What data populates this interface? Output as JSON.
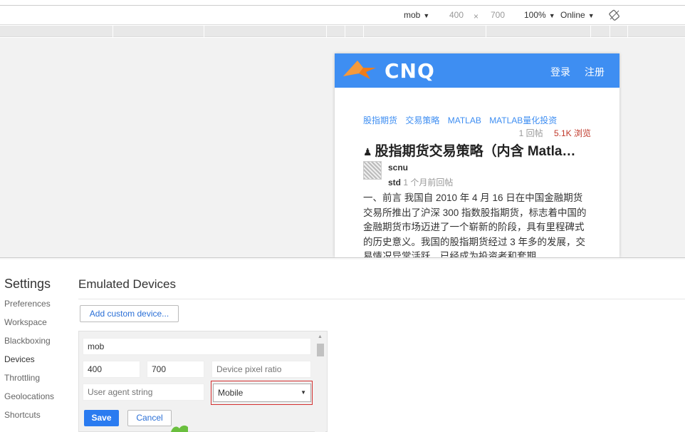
{
  "toolbar": {
    "device": "mob",
    "width": "400",
    "times": "×",
    "height": "700",
    "zoom": "100%",
    "network": "Online",
    "arrow": "▼"
  },
  "site": {
    "logo_text": "CNQ",
    "login": "登录",
    "register": "注册",
    "brand_color": "#3e8ef2"
  },
  "post": {
    "tags": [
      "股指期货",
      "交易策略",
      "MATLAB",
      "MATLAB量化投资"
    ],
    "replies": "1 回帖",
    "views": "5.1K 浏览",
    "pin_icon": "♟",
    "title": "股指期货交易策略（内含 Matla…",
    "author": "scnu",
    "sub_user": "std",
    "sub_time": "1 个月前回帖",
    "body": "一、前言 我国自 2010 年 4 月 16 日在中国金融期货交易所推出了沪深 300 指数股指期货，标志着中国的金融期货市场迈进了一个崭新的阶段，具有里程碑式的历史意义。我国的股指期货经过 3 年多的发展，交易情况异常活跃，已经成为投资者和套期"
  },
  "settings": {
    "title": "Settings",
    "nav": [
      "Preferences",
      "Workspace",
      "Blackboxing",
      "Devices",
      "Throttling",
      "Geolocations",
      "Shortcuts"
    ],
    "active_nav": "Devices",
    "section_title": "Emulated Devices",
    "add_button": "Add custom device...",
    "form": {
      "name_value": "mob",
      "width_value": "400",
      "height_value": "700",
      "dpr_placeholder": "Device pixel ratio",
      "ua_placeholder": "User agent string",
      "type_value": "Mobile",
      "select_arrow": "▼",
      "save": "Save",
      "cancel": "Cancel"
    },
    "scroll_up": "▲"
  }
}
